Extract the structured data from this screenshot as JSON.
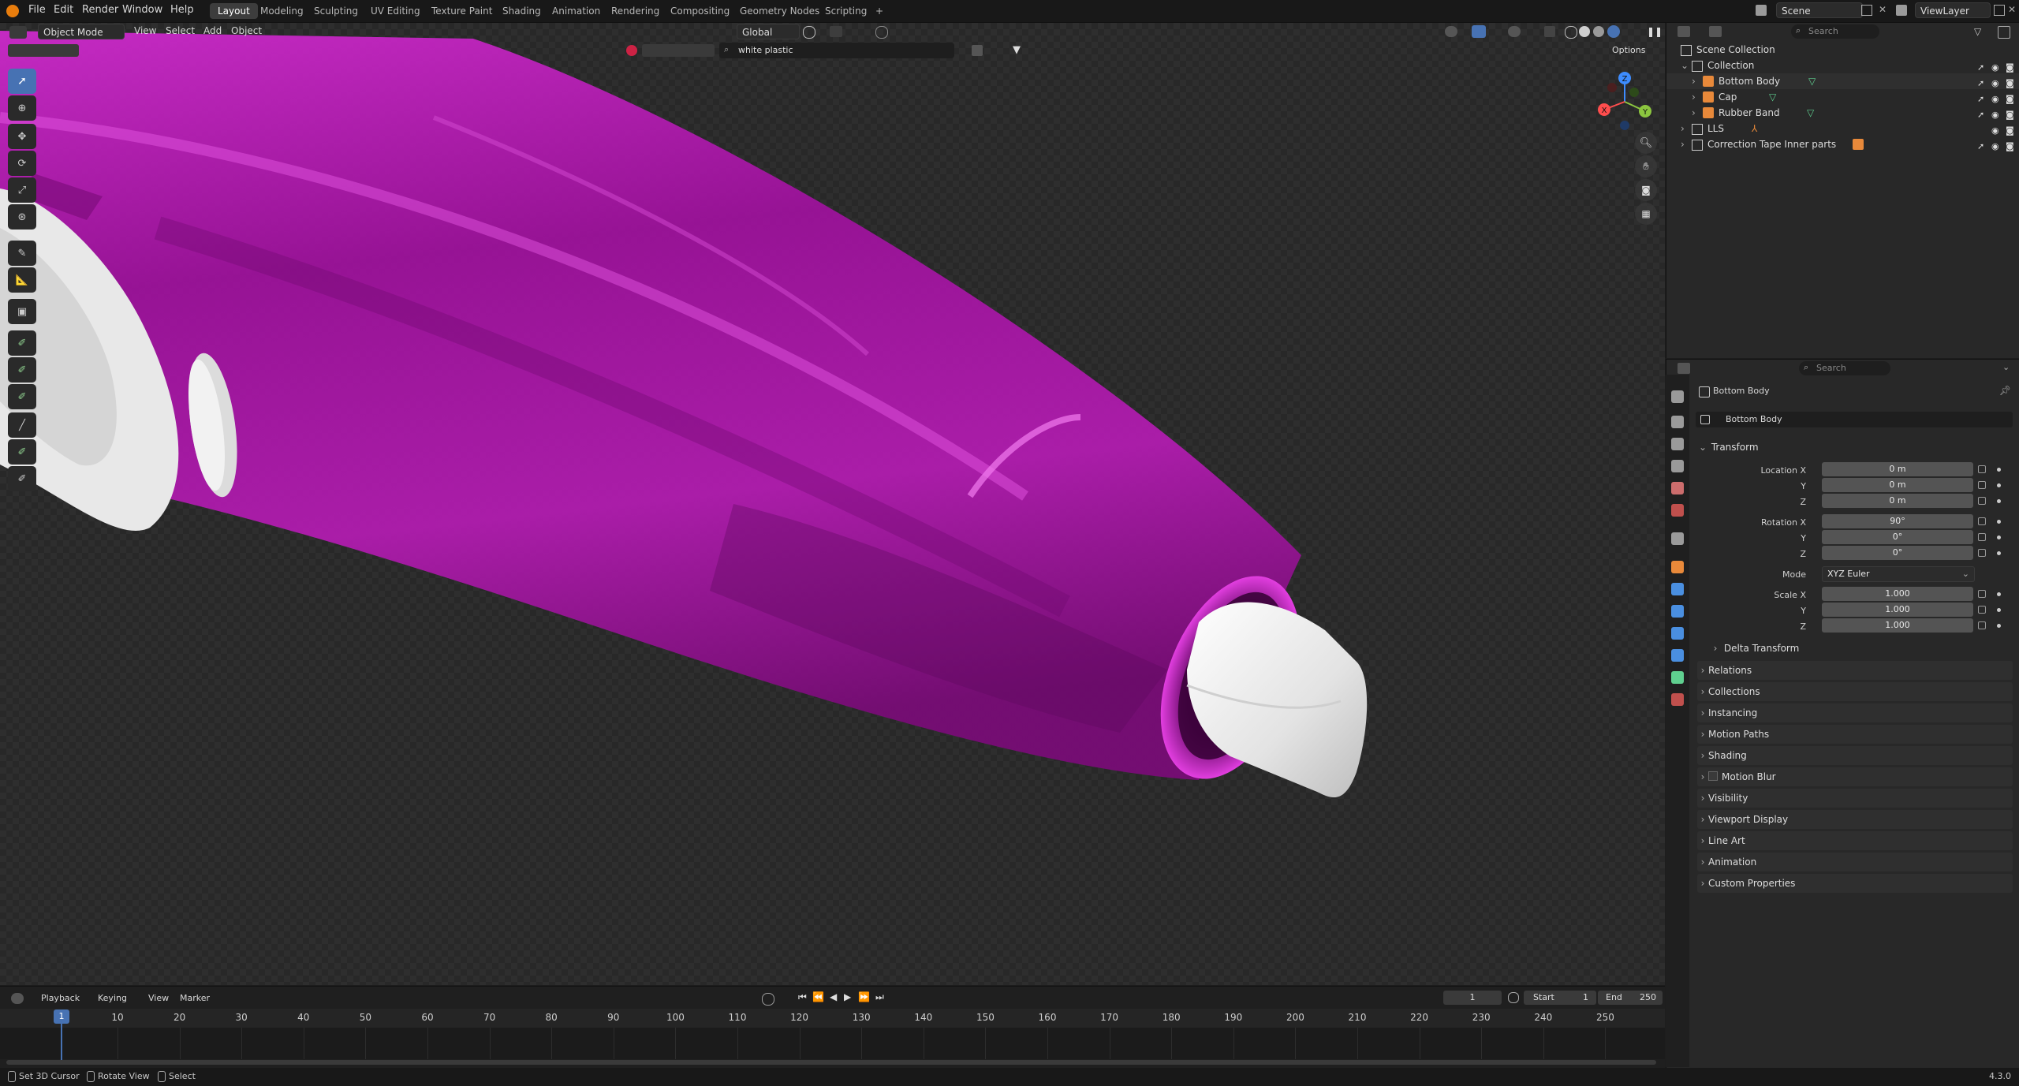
{
  "topbar": {
    "menus": [
      "File",
      "Edit",
      "Render",
      "Window",
      "Help"
    ],
    "workspaces": [
      "Layout",
      "Modeling",
      "Sculpting",
      "UV Editing",
      "Texture Paint",
      "Shading",
      "Animation",
      "Rendering",
      "Compositing",
      "Geometry Nodes",
      "Scripting"
    ],
    "active_workspace": "Layout",
    "add_tab": "+",
    "scene": "Scene",
    "view_layer": "ViewLayer"
  },
  "viewport": {
    "mode": "Object Mode",
    "menus": [
      "View",
      "Select",
      "Add",
      "Object"
    ],
    "transform_orientation": "Global",
    "filter_value": "white plastic",
    "options_label": "Options",
    "gizmo_axes": [
      "X",
      "Y",
      "Z"
    ]
  },
  "outliner": {
    "search_placeholder": "Search",
    "scene_collection": "Scene Collection",
    "items": [
      {
        "label": "Collection",
        "indent": 1
      },
      {
        "label": "Bottom Body",
        "indent": 2
      },
      {
        "label": "Cap",
        "indent": 2
      },
      {
        "label": "Rubber Band",
        "indent": 2
      },
      {
        "label": "LLS",
        "indent": 1
      },
      {
        "label": "Correction Tape Inner parts",
        "indent": 1
      }
    ]
  },
  "properties": {
    "search_placeholder": "Search",
    "object_name": "Bottom Body",
    "data_name": "Bottom Body",
    "transform_label": "Transform",
    "location_label": "Location X",
    "rotation_label": "Rotation X",
    "scale_label": "Scale X",
    "y_label": "Y",
    "z_label": "Z",
    "location": [
      "0 m",
      "0 m",
      "0 m"
    ],
    "rotation": [
      "90°",
      "0°",
      "0°"
    ],
    "mode_label": "Mode",
    "mode_value": "XYZ Euler",
    "scale": [
      "1.000",
      "1.000",
      "1.000"
    ],
    "delta_transform": "Delta Transform",
    "panels": [
      "Relations",
      "Collections",
      "Instancing",
      "Motion Paths",
      "Shading",
      "Motion Blur",
      "Visibility",
      "Viewport Display",
      "Line Art",
      "Animation",
      "Custom Properties"
    ]
  },
  "timeline": {
    "menus": [
      "Playback",
      "Keying",
      "View",
      "Marker"
    ],
    "current_frame": "1",
    "start_label": "Start",
    "start_value": "1",
    "end_label": "End",
    "end_value": "250",
    "ticks": [
      "10",
      "20",
      "30",
      "40",
      "50",
      "60",
      "70",
      "80",
      "90",
      "100",
      "110",
      "120",
      "130",
      "140",
      "150",
      "160",
      "170",
      "180",
      "190",
      "200",
      "210",
      "220",
      "230",
      "240",
      "250"
    ]
  },
  "statusbar": {
    "hints": [
      "Set 3D Cursor",
      "Rotate View",
      "Select"
    ],
    "version": "4.3.0"
  },
  "colors": {
    "accent_blue": "#4772b3",
    "object_magenta": "#b10fb0",
    "plastic_white": "#e6e6e6",
    "header_bg": "#181818",
    "panel_bg": "#282828"
  }
}
